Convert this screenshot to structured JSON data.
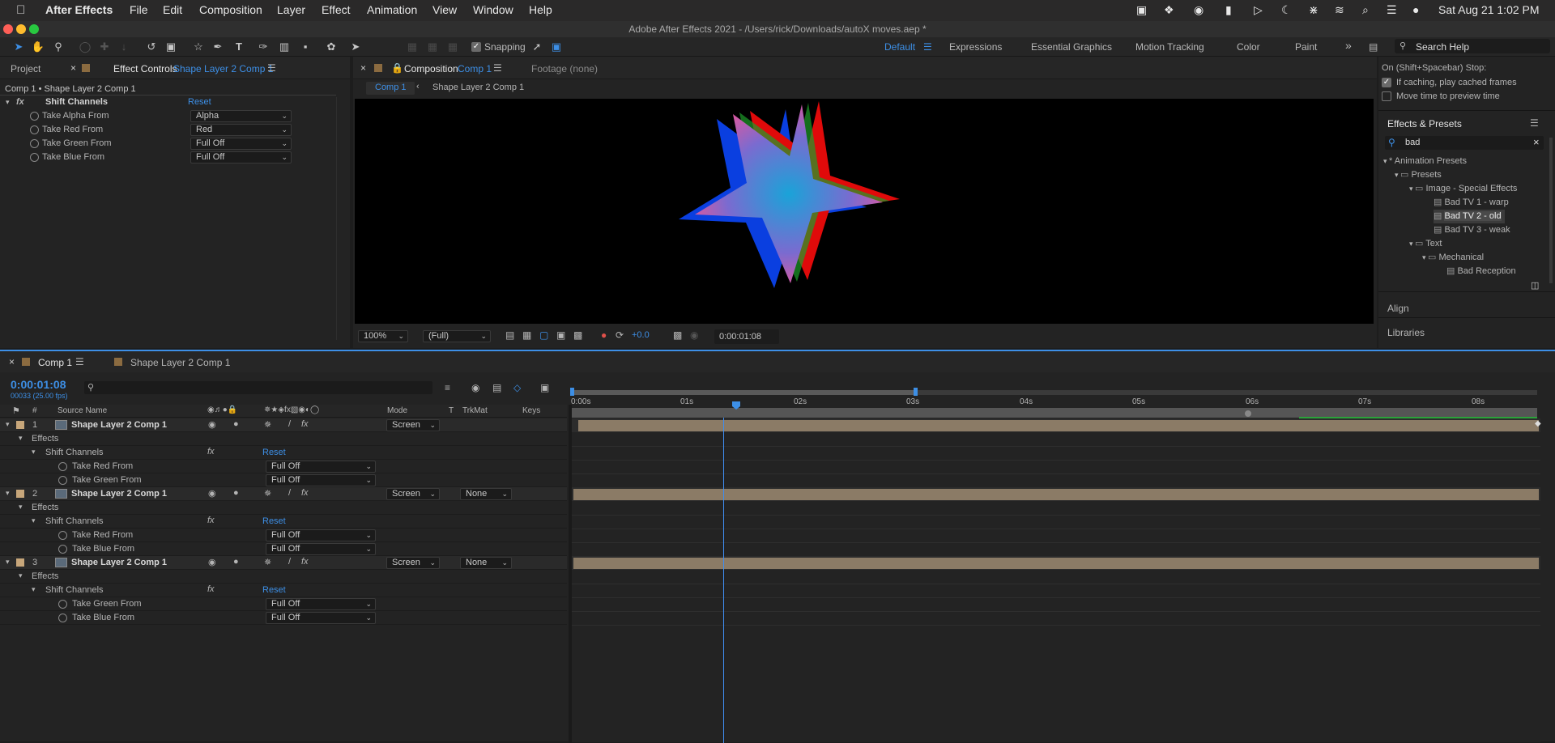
{
  "menubar": {
    "app": "After Effects",
    "items": [
      "File",
      "Edit",
      "Composition",
      "Layer",
      "Effect",
      "Animation",
      "View",
      "Window",
      "Help"
    ],
    "clock": "Sat Aug 21  1:02 PM"
  },
  "window": {
    "title": "Adobe After Effects 2021 - /Users/rick/Downloads/autoX moves.aep *"
  },
  "toolbar": {
    "snapping_label": "Snapping",
    "workspaces": [
      "Default",
      "Expressions",
      "Essential Graphics",
      "Motion Tracking",
      "Color",
      "Paint"
    ],
    "search_placeholder": "Search Help"
  },
  "left_panel": {
    "tab_project": "Project",
    "tab_effect_controls": "Effect Controls",
    "tab_layer": "Shape Layer 2 Comp 1",
    "breadcrumb": "Comp 1 • Shape Layer 2 Comp 1",
    "effect_name": "Shift Channels",
    "reset": "Reset",
    "props": [
      {
        "label": "Take Alpha From",
        "value": "Alpha"
      },
      {
        "label": "Take Red From",
        "value": "Red"
      },
      {
        "label": "Take Green From",
        "value": "Full Off"
      },
      {
        "label": "Take Blue From",
        "value": "Full Off"
      }
    ]
  },
  "comp_panel": {
    "tab_label": "Composition",
    "tab_comp": "Comp 1",
    "footage_tab": "Footage (none)",
    "breadcrumb_comp": "Comp 1",
    "breadcrumb_layer": "Shape Layer 2 Comp 1",
    "zoom": "100%",
    "resolution": "(Full)",
    "exposure": "+0.0",
    "timecode": "0:00:01:08"
  },
  "right_panel": {
    "preview_stop_label": "On (Shift+Spacebar) Stop:",
    "opt_cached": "If caching, play cached frames",
    "opt_move_time": "Move time to preview time",
    "effects_title": "Effects & Presets",
    "search_value": "bad",
    "tree": [
      {
        "label": "* Animation Presets",
        "level": 0
      },
      {
        "label": "Presets",
        "level": 1
      },
      {
        "label": "Image - Special Effects",
        "level": 2
      },
      {
        "label": "Bad TV 1 - warp",
        "level": 3
      },
      {
        "label": "Bad TV 2 - old",
        "level": 3
      },
      {
        "label": "Bad TV 3 - weak",
        "level": 3
      },
      {
        "label": "Text",
        "level": 2
      },
      {
        "label": "Mechanical",
        "level": 3
      },
      {
        "label": "Bad Reception",
        "level": 4
      }
    ],
    "align": "Align",
    "libraries": "Libraries"
  },
  "timeline": {
    "tab_comp": "Comp 1",
    "tab_other": "Shape Layer 2 Comp 1",
    "timecode": "0:00:01:08",
    "fps": "00033 (25.00 fps)",
    "col_source": "Source Name",
    "col_mode": "Mode",
    "col_t": "T",
    "col_trkmat": "TrkMat",
    "col_keys": "Keys",
    "hash": "#",
    "ruler": [
      "0:00s",
      "01s",
      "02s",
      "03s",
      "04s",
      "05s",
      "06s",
      "07s",
      "08s"
    ],
    "layers": [
      {
        "num": "1",
        "name": "Shape Layer 2 Comp 1",
        "mode": "Screen",
        "trkmat": "",
        "effects": "Effects",
        "effect": "Shift Channels",
        "reset": "Reset",
        "props": [
          {
            "label": "Take Red From",
            "value": "Full Off"
          },
          {
            "label": "Take Green From",
            "value": "Full Off"
          }
        ]
      },
      {
        "num": "2",
        "name": "Shape Layer 2 Comp 1",
        "mode": "Screen",
        "trkmat": "None",
        "effects": "Effects",
        "effect": "Shift Channels",
        "reset": "Reset",
        "props": [
          {
            "label": "Take Red From",
            "value": "Full Off"
          },
          {
            "label": "Take Blue From",
            "value": "Full Off"
          }
        ]
      },
      {
        "num": "3",
        "name": "Shape Layer 2 Comp 1",
        "mode": "Screen",
        "trkmat": "None",
        "effects": "Effects",
        "effect": "Shift Channels",
        "reset": "Reset",
        "props": [
          {
            "label": "Take Green From",
            "value": "Full Off"
          },
          {
            "label": "Take Blue From",
            "value": "Full Off"
          }
        ]
      }
    ]
  },
  "colors": {
    "accent": "#3d8fe6",
    "layer_bar": "#8b7b66",
    "label_swatch": "#c7a67a"
  }
}
